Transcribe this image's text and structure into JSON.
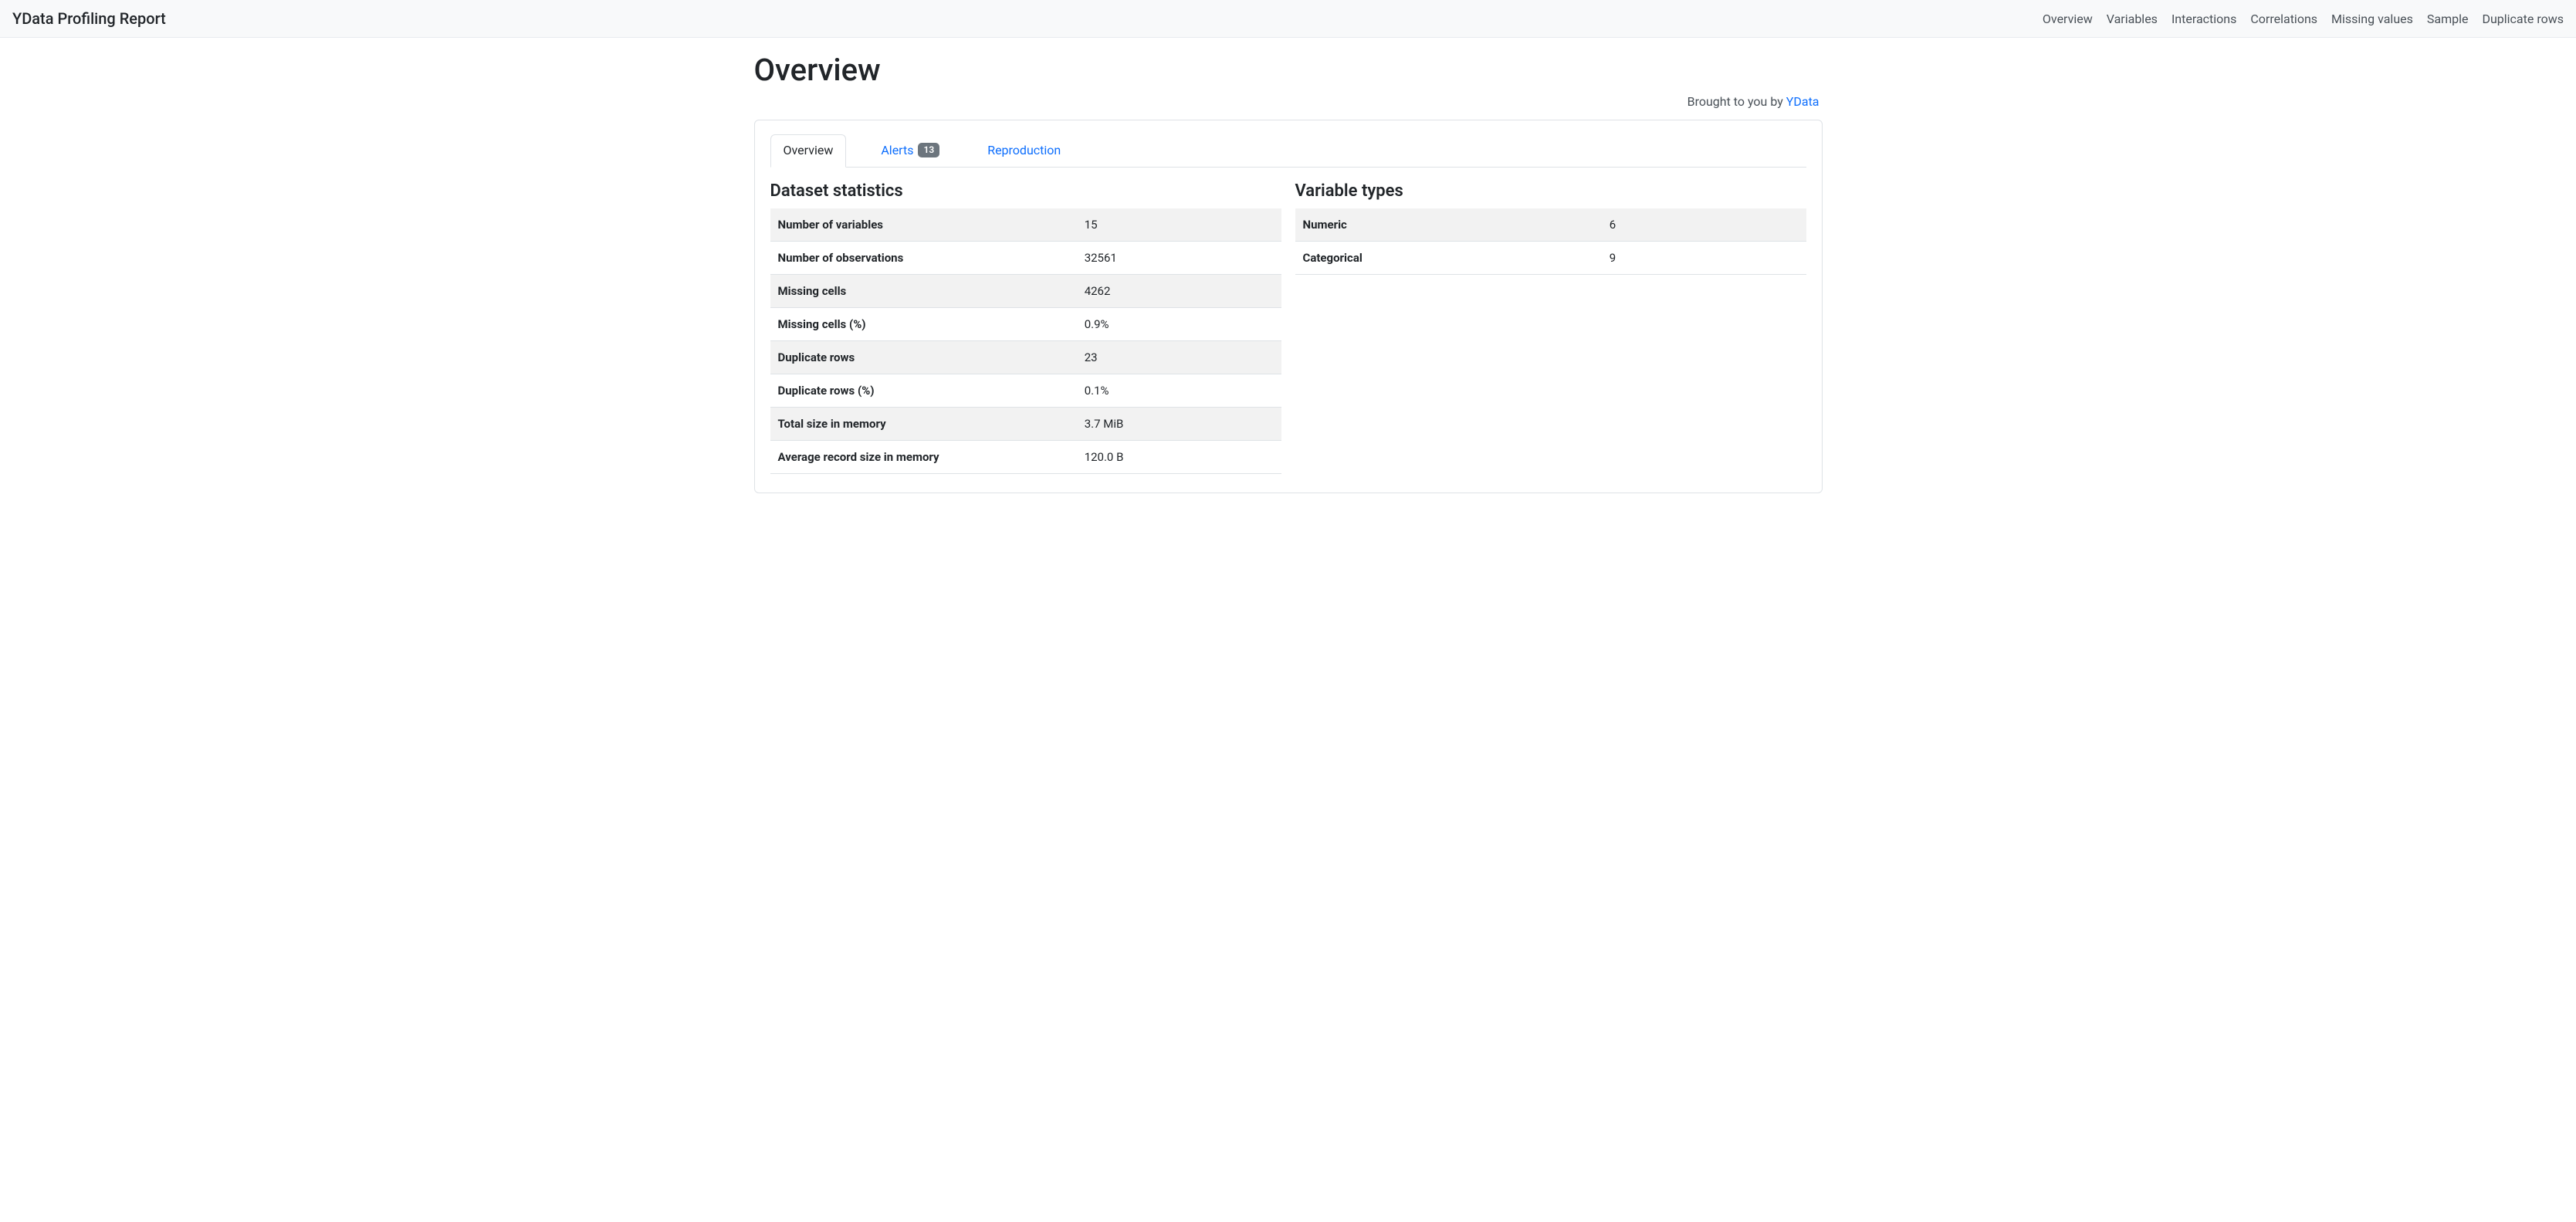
{
  "navbar": {
    "brand": "YData Profiling Report",
    "links": [
      "Overview",
      "Variables",
      "Interactions",
      "Correlations",
      "Missing values",
      "Sample",
      "Duplicate rows"
    ]
  },
  "page_title": "Overview",
  "credit": {
    "prefix": "Brought to you by ",
    "link_text": "YData"
  },
  "tabs": {
    "overview": "Overview",
    "alerts": "Alerts",
    "alerts_badge": "13",
    "reproduction": "Reproduction"
  },
  "dataset_stats": {
    "heading": "Dataset statistics",
    "rows": [
      {
        "label": "Number of variables",
        "value": "15"
      },
      {
        "label": "Number of observations",
        "value": "32561"
      },
      {
        "label": "Missing cells",
        "value": "4262"
      },
      {
        "label": "Missing cells (%)",
        "value": "0.9%"
      },
      {
        "label": "Duplicate rows",
        "value": "23"
      },
      {
        "label": "Duplicate rows (%)",
        "value": "0.1%"
      },
      {
        "label": "Total size in memory",
        "value": "3.7 MiB"
      },
      {
        "label": "Average record size in memory",
        "value": "120.0 B"
      }
    ]
  },
  "variable_types": {
    "heading": "Variable types",
    "rows": [
      {
        "label": "Numeric",
        "value": "6"
      },
      {
        "label": "Categorical",
        "value": "9"
      }
    ]
  }
}
